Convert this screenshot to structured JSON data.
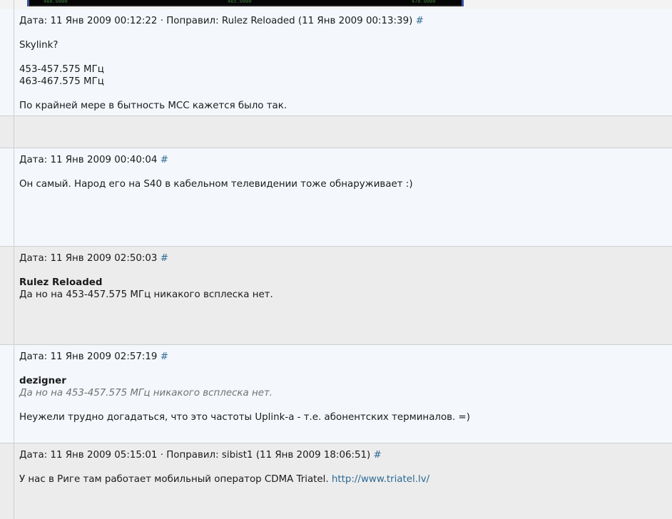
{
  "posts": [
    {
      "date_label": "Дата:",
      "date": "11 Янв 2009 00:12:22",
      "separator": "·",
      "edited_label": "Поправил:",
      "edited_by": "Rulez Reloaded",
      "edited_date": "(11 Янв 2009 00:13:39)",
      "permalink": "#",
      "lines": [
        "Skylink?",
        "453-457.575 МГц",
        "463-467.575 МГц",
        "По крайней мере в бытность МСС кажется было так."
      ]
    },
    {
      "date_label": "Дата:",
      "date": "11 Янв 2009 00:40:04",
      "permalink": "#",
      "text": "Он самый. Народ его на S40 в кабельном телевидении тоже обнаруживает :)"
    },
    {
      "date_label": "Дата:",
      "date": "11 Янв 2009 02:50:03",
      "permalink": "#",
      "quote_author": "Rulez Reloaded",
      "text": "Да но на 453-457.575 МГц никакого всплеска нет."
    },
    {
      "date_label": "Дата:",
      "date": "11 Янв 2009 02:57:19",
      "permalink": "#",
      "quote_author": "dezigner",
      "quote_text": "Да но на 453-457.575 МГц никакого всплеска нет.",
      "text": "Неужели трудно догадаться, что это частоты Uplink-а - т.е. абонентских терминалов. =)"
    },
    {
      "date_label": "Дата:",
      "date": "11 Янв 2009 05:15:01",
      "separator": "·",
      "edited_label": "Поправил:",
      "edited_by": "sibist1",
      "edited_date": "(11 Янв 2009 18:06:51)",
      "permalink": "#",
      "text": "У нас в Риге там работает мобильный оператор CDMA Triatel.",
      "link": "http://www.triatel.lv/"
    }
  ],
  "top_image": {
    "ticks": [
      "460.0000",
      "465.0000",
      "470.0000"
    ]
  }
}
